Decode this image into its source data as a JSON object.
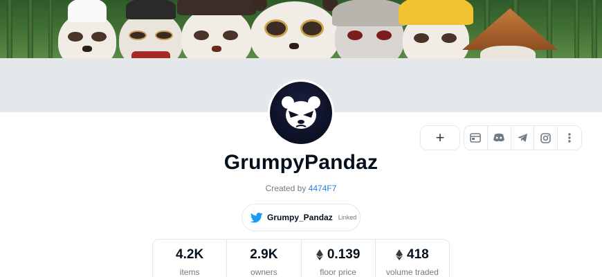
{
  "collection": {
    "name": "GrumpyPandaz",
    "created_by_prefix": "Created by",
    "creator": "4474F7"
  },
  "twitter": {
    "handle": "Grumpy_Pandaz",
    "status": "Linked"
  },
  "actions": {
    "add_label": "+"
  },
  "social_icons": [
    "website-icon",
    "discord-icon",
    "telegram-icon",
    "instagram-icon",
    "more-icon"
  ],
  "stats": [
    {
      "value": "4.2K",
      "label": "items",
      "eth": false
    },
    {
      "value": "2.9K",
      "label": "owners",
      "eth": false
    },
    {
      "value": "0.139",
      "label": "floor price",
      "eth": true
    },
    {
      "value": "418",
      "label": "volume traded",
      "eth": true
    }
  ],
  "colors": {
    "link": "#2081e2",
    "twitter": "#1d9bf0",
    "muted": "#707a83",
    "strip": "#e5e8eb"
  }
}
